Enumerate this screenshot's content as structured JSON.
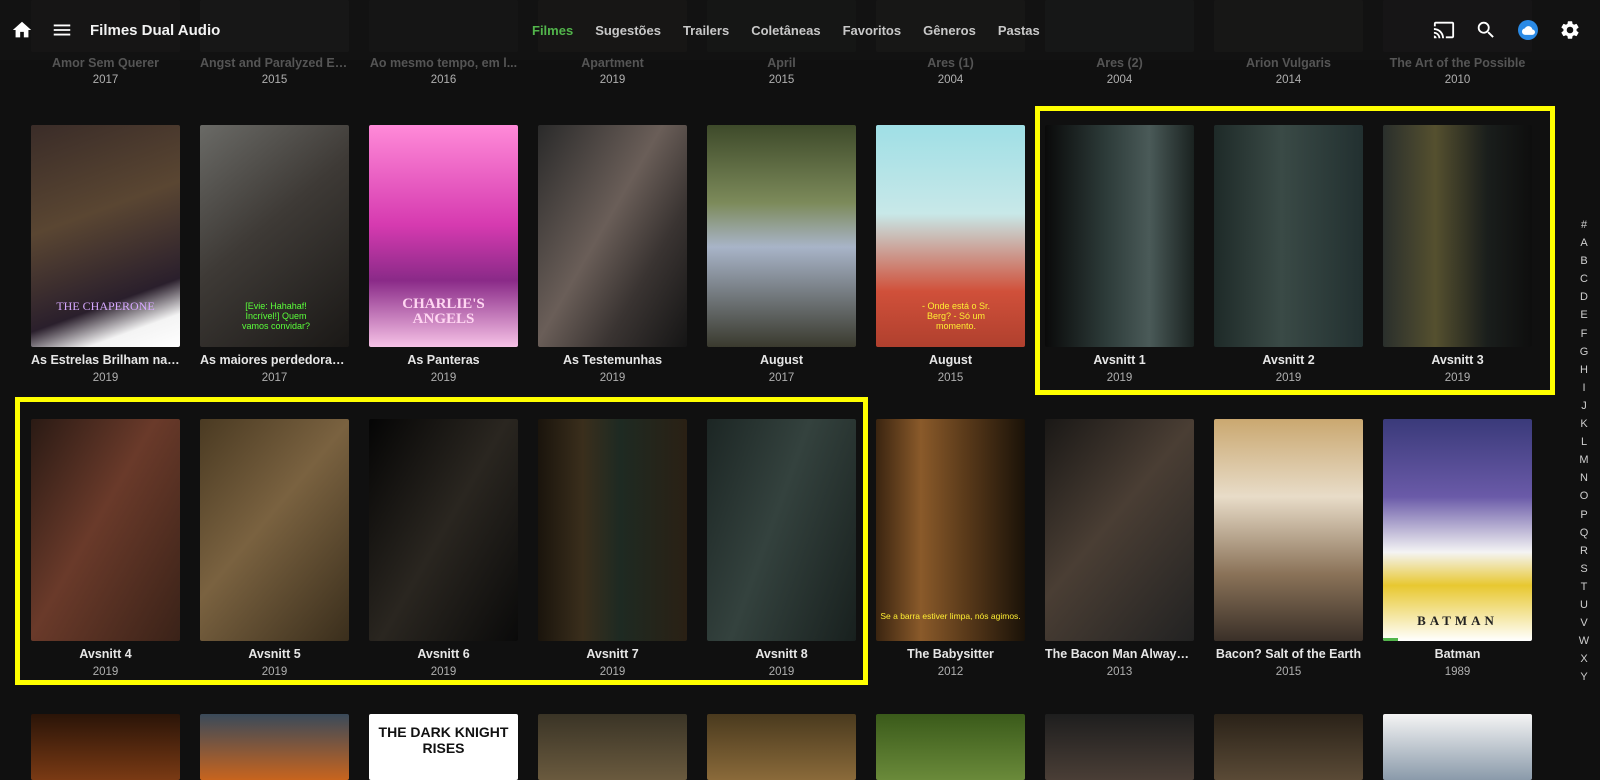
{
  "header": {
    "title": "Filmes Dual Audio",
    "tabs": [
      "Filmes",
      "Sugestões",
      "Trailers",
      "Coletâneas",
      "Favoritos",
      "Gêneros",
      "Pastas"
    ],
    "active_tab": "Filmes"
  },
  "top_row": [
    {
      "title": "Amor Sem Querer",
      "year": "2017"
    },
    {
      "title": "Angst and Paralyzed Es...",
      "year": "2015"
    },
    {
      "title": "Ao mesmo tempo, em l...",
      "year": "2016"
    },
    {
      "title": "Apartment",
      "year": "2019"
    },
    {
      "title": "April",
      "year": "2015"
    },
    {
      "title": "Ares (1)",
      "year": "2004"
    },
    {
      "title": "Ares (2)",
      "year": "2004"
    },
    {
      "title": "Arion Vulgaris",
      "year": "2014"
    },
    {
      "title": "The Art of the Possible",
      "year": "2010"
    }
  ],
  "row1": [
    {
      "title": "As Estrelas Brilham na ...",
      "year": "2019"
    },
    {
      "title": "As maiores perdedoras ...",
      "year": "2017"
    },
    {
      "title": "As Panteras",
      "year": "2019"
    },
    {
      "title": "As Testemunhas",
      "year": "2019"
    },
    {
      "title": "August",
      "year": "2017"
    },
    {
      "title": "August",
      "year": "2015"
    },
    {
      "title": "Avsnitt 1",
      "year": "2019"
    },
    {
      "title": "Avsnitt 2",
      "year": "2019"
    },
    {
      "title": "Avsnitt 3",
      "year": "2019"
    }
  ],
  "row2": [
    {
      "title": "Avsnitt 4",
      "year": "2019"
    },
    {
      "title": "Avsnitt 5",
      "year": "2019"
    },
    {
      "title": "Avsnitt 6",
      "year": "2019"
    },
    {
      "title": "Avsnitt 7",
      "year": "2019"
    },
    {
      "title": "Avsnitt 8",
      "year": "2019"
    },
    {
      "title": "The Babysitter",
      "year": "2012"
    },
    {
      "title": "The Bacon Man Always ...",
      "year": "2013"
    },
    {
      "title": "Bacon? Salt of the Earth",
      "year": "2015"
    },
    {
      "title": "Batman",
      "year": "1989"
    }
  ],
  "posters": {
    "chaperone_text": "THE CHAPERONE",
    "charlies_angels_text": "CHARLIE'S ANGELS",
    "dark_knight_text": "THE DARK KNIGHT RISES",
    "batman_text": "BATMAN",
    "subtitle_1": "[Evie: Hahahaf! Incrível!] Quem vamos convidar?",
    "subtitle_2": "- Onde está o Sr. Berg? - Só um momento.",
    "subtitle_3": "Se a barra estiver limpa, nós agimos."
  },
  "batman_progress": 0.1,
  "alphabet": [
    "#",
    "A",
    "B",
    "C",
    "D",
    "E",
    "F",
    "G",
    "H",
    "I",
    "J",
    "K",
    "L",
    "M",
    "N",
    "O",
    "P",
    "Q",
    "R",
    "S",
    "T",
    "U",
    "V",
    "W",
    "X",
    "Y"
  ],
  "colors": {
    "accent": "#52b54b",
    "highlight": "#ffff00",
    "background": "#101010"
  }
}
